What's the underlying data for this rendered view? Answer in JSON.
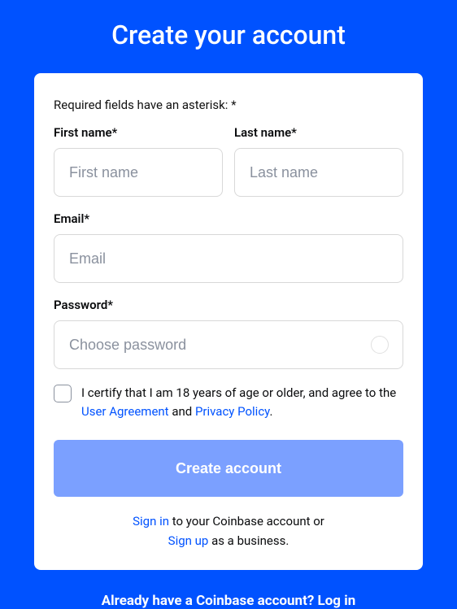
{
  "title": "Create your account",
  "required_note": "Required fields have an asterisk: *",
  "fields": {
    "first_name": {
      "label": "First name*",
      "placeholder": "First name"
    },
    "last_name": {
      "label": "Last name*",
      "placeholder": "Last name"
    },
    "email": {
      "label": "Email*",
      "placeholder": "Email"
    },
    "password": {
      "label": "Password*",
      "placeholder": "Choose password"
    }
  },
  "consent": {
    "prefix": "I certify that I am 18 years of age or older, and agree to the ",
    "user_agreement": "User Agreement",
    "and": " and ",
    "privacy_policy": "Privacy Policy",
    "suffix": "."
  },
  "submit_label": "Create account",
  "alt": {
    "sign_in": "Sign in",
    "sign_in_suffix": " to your Coinbase account or",
    "sign_up": "Sign up",
    "sign_up_suffix": " as a business."
  },
  "footer": {
    "prefix": "Already have a Coinbase account? ",
    "login": "Log in"
  }
}
